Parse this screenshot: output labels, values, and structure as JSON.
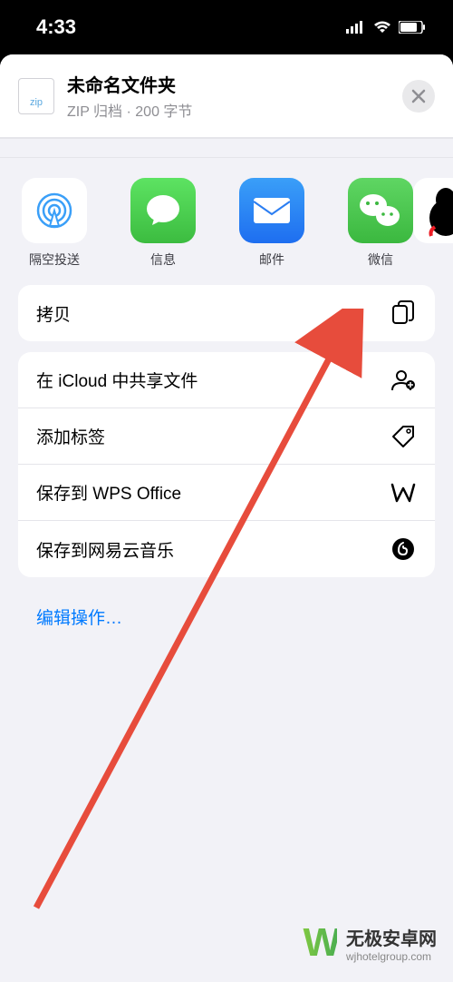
{
  "status": {
    "time": "4:33"
  },
  "file": {
    "thumb_label": "zip",
    "title": "未命名文件夹",
    "subtitle": "ZIP 归档 · 200 字节"
  },
  "apps": [
    {
      "id": "airdrop",
      "label": "隔空投送"
    },
    {
      "id": "messages",
      "label": "信息"
    },
    {
      "id": "mail",
      "label": "邮件"
    },
    {
      "id": "wechat",
      "label": "微信"
    }
  ],
  "actions": {
    "copy": "拷贝",
    "icloud_share": "在 iCloud 中共享文件",
    "add_tag": "添加标签",
    "save_wps": "保存到 WPS Office",
    "save_netease": "保存到网易云音乐",
    "edit": "编辑操作…"
  },
  "watermark": {
    "main": "无极安卓网",
    "sub": "wjhotelgroup.com"
  }
}
